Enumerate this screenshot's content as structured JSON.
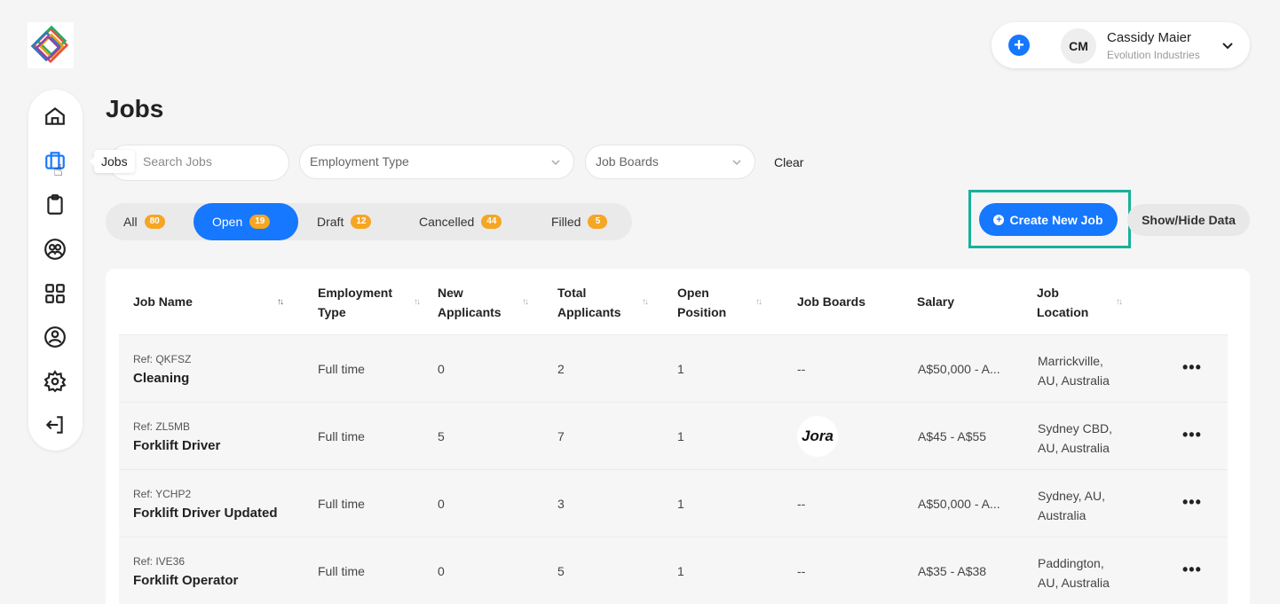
{
  "header": {
    "page_title": "Jobs",
    "user": {
      "initials": "CM",
      "name": "Cassidy Maier",
      "organization": "Evolution Industries"
    }
  },
  "sidebar": {
    "tooltip": "Jobs",
    "items": [
      {
        "icon": "home-icon"
      },
      {
        "icon": "briefcase-icon",
        "active": true
      },
      {
        "icon": "clipboard-icon"
      },
      {
        "icon": "users-icon"
      },
      {
        "icon": "grid-icon"
      },
      {
        "icon": "user-pin-icon"
      },
      {
        "icon": "gear-icon"
      },
      {
        "icon": "logout-icon"
      }
    ]
  },
  "filters": {
    "search_placeholder": "Search Jobs",
    "employment_type_placeholder": "Employment Type",
    "job_boards_placeholder": "Job Boards",
    "clear_label": "Clear"
  },
  "tabs": [
    {
      "label": "All",
      "count": "80"
    },
    {
      "label": "Open",
      "count": "19",
      "active": true
    },
    {
      "label": "Draft",
      "count": "12"
    },
    {
      "label": "Cancelled",
      "count": "44"
    },
    {
      "label": "Filled",
      "count": "5"
    }
  ],
  "actions": {
    "create_label": "Create New Job",
    "show_hide_label": "Show/Hide Data"
  },
  "table": {
    "columns": [
      {
        "line1": "Job Name",
        "line2": ""
      },
      {
        "line1": "Employment",
        "line2": "Type"
      },
      {
        "line1": "New",
        "line2": "Applicants"
      },
      {
        "line1": "Total",
        "line2": "Applicants"
      },
      {
        "line1": "Open",
        "line2": "Position"
      },
      {
        "line1": "Job Boards",
        "line2": ""
      },
      {
        "line1": "Salary",
        "line2": ""
      },
      {
        "line1": "Job",
        "line2": "Location"
      }
    ],
    "rows": [
      {
        "ref": "Ref: QKFSZ",
        "name": "Cleaning",
        "type": "Full time",
        "new": "0",
        "total": "2",
        "open": "1",
        "boards": "--",
        "salary": "A$50,000 - A...",
        "loc1": "Marrickville,",
        "loc2": "AU, Australia",
        "more": "•••"
      },
      {
        "ref": "Ref: ZL5MB",
        "name": "Forklift Driver",
        "type": "Full time",
        "new": "5",
        "total": "7",
        "open": "1",
        "boards": "Jora",
        "salary": "A$45 - A$55",
        "loc1": "Sydney CBD,",
        "loc2": "AU, Australia",
        "more": "•••"
      },
      {
        "ref": "Ref: YCHP2",
        "name": "Forklift Driver Updated",
        "type": "Full time",
        "new": "0",
        "total": "3",
        "open": "1",
        "boards": "--",
        "salary": "A$50,000 - A...",
        "loc1": "Sydney, AU,",
        "loc2": "Australia",
        "more": "•••"
      },
      {
        "ref": "Ref: IVE36",
        "name": "Forklift Operator",
        "type": "Full time",
        "new": "0",
        "total": "5",
        "open": "1",
        "boards": "--",
        "salary": "A$35 - A$38",
        "loc1": "Paddington,",
        "loc2": "AU, Australia",
        "more": "•••"
      }
    ]
  },
  "colors": {
    "primary": "#1677ff",
    "badge": "#f5a623",
    "highlight": "#18b09a"
  }
}
